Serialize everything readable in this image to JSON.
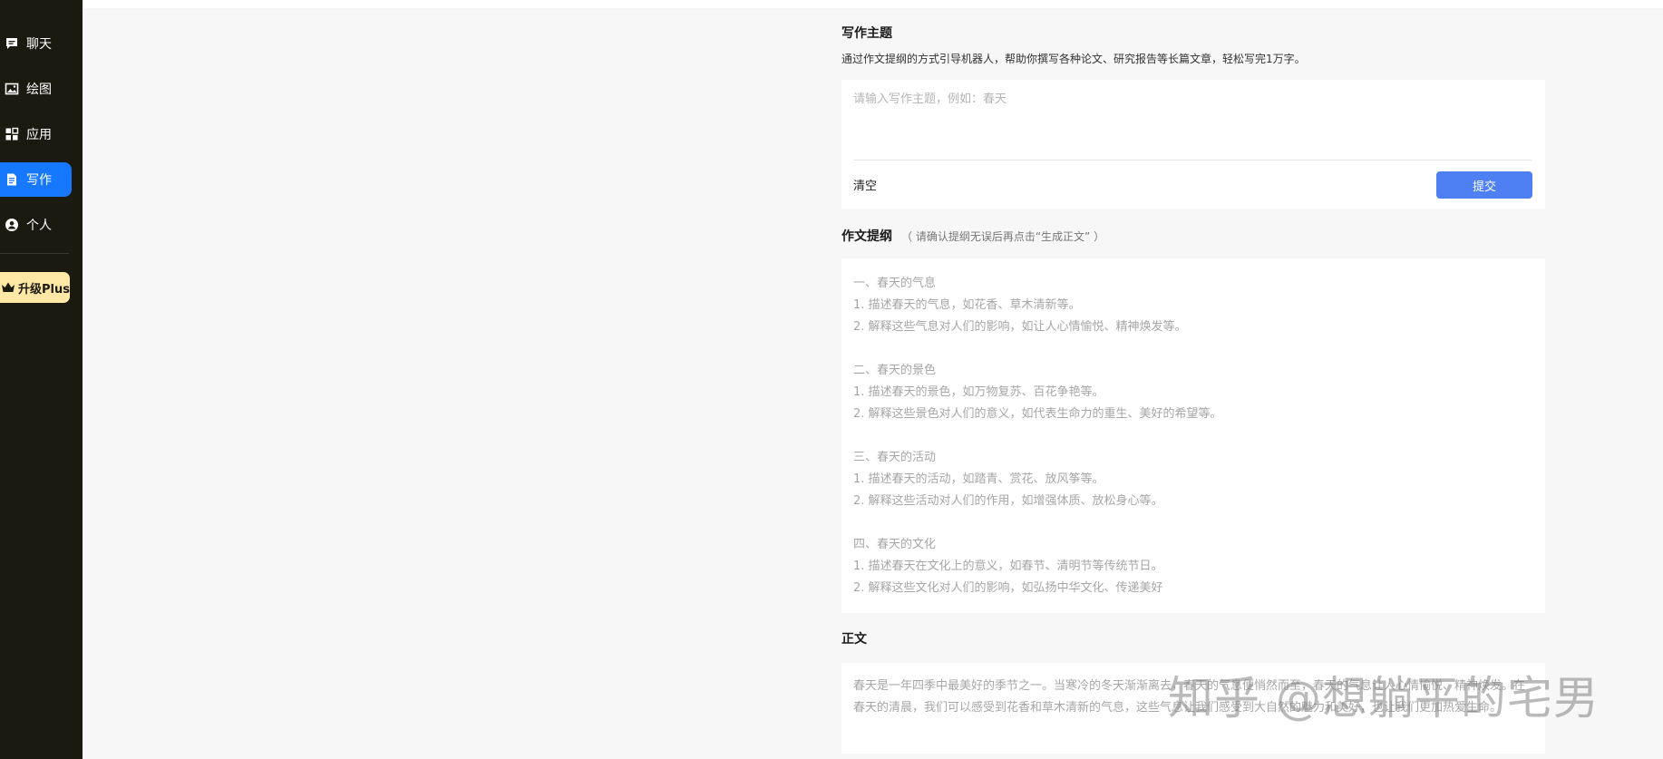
{
  "sidebar": {
    "items": [
      {
        "label": "聊天",
        "icon": "chat-icon"
      },
      {
        "label": "绘图",
        "icon": "image-icon"
      },
      {
        "label": "应用",
        "icon": "apps-icon"
      },
      {
        "label": "写作",
        "icon": "document-icon",
        "active": true
      },
      {
        "label": "个人",
        "icon": "user-icon"
      }
    ],
    "upgrade_label": "升级Plus",
    "upgrade_icon": "crown-icon"
  },
  "topic": {
    "title": "写作主题",
    "description": "通过作文提纲的方式引导机器人，帮助你撰写各种论文、研究报告等长篇文章，轻松写完1万字。",
    "placeholder": "请输入写作主题，例如：春天",
    "value": "",
    "clear_label": "清空",
    "submit_label": "提交"
  },
  "outline": {
    "title": "作文提纲",
    "hint": "（ 请确认提纲无误后再点击“生成正文” ）",
    "lines": [
      "一、春天的气息",
      "1. 描述春天的气息，如花香、草木清新等。",
      "2. 解释这些气息对人们的影响，如让人心情愉悦、精神焕发等。",
      "",
      "二、春天的景色",
      "1. 描述春天的景色，如万物复苏、百花争艳等。",
      "2. 解释这些景色对人们的意义，如代表生命力的重生、美好的希望等。",
      "",
      "三、春天的活动",
      "1. 描述春天的活动，如踏青、赏花、放风筝等。",
      "2. 解释这些活动对人们的作用，如增强体质、放松身心等。",
      "",
      "四、春天的文化",
      "1. 描述春天在文化上的意义，如春节、清明节等传统节日。",
      "2. 解释这些文化对人们的影响，如弘扬中华文化、传递美好"
    ]
  },
  "body": {
    "title": "正文",
    "text": "春天是一年四季中最美好的季节之一。当寒冷的冬天渐渐离去，春天的气息便悄然而至，春天的气息让人心情愉悦、精神焕发。在春天的清晨，我们可以感受到花香和草木清新的气息，这些气息让我们感受到大自然的魅力和美好，也让我们更加热爱生命。"
  },
  "watermark": "知乎 @想躺平的宅男",
  "colors": {
    "sidebar_bg": "#1b1a10",
    "active_item": "#1677ff",
    "upgrade_bg": "#ffe7a6",
    "submit_bg": "#4e80f3"
  }
}
